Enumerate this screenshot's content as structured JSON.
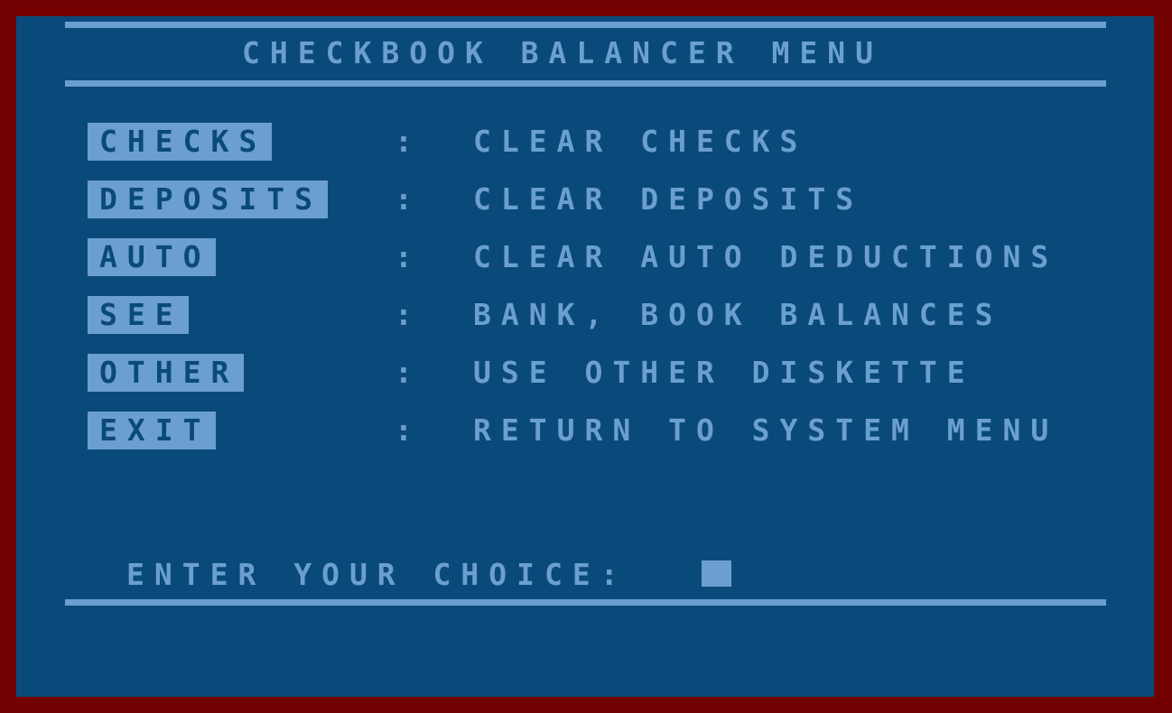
{
  "screen": {
    "title": "CHECKBOOK BALANCER MENU",
    "bezel_color": "#730000",
    "background_color": "#0a4a7a",
    "text_color": "#6b9fd0",
    "highlight_bg_color": "#6b9fd0",
    "highlight_text_color": "#0a4a7a"
  },
  "menu": {
    "separator": ":",
    "items": [
      {
        "keyword": "CHECKS",
        "description": "CLEAR CHECKS"
      },
      {
        "keyword": "DEPOSITS",
        "description": "CLEAR DEPOSITS"
      },
      {
        "keyword": "AUTO",
        "description": "CLEAR AUTO DEDUCTIONS"
      },
      {
        "keyword": "SEE",
        "description": "BANK, BOOK BALANCES"
      },
      {
        "keyword": "OTHER",
        "description": "USE OTHER DISKETTE"
      },
      {
        "keyword": "EXIT",
        "description": "RETURN TO SYSTEM MENU"
      }
    ]
  },
  "prompt": {
    "label": "ENTER YOUR CHOICE:",
    "value": "",
    "cursor": "block-cursor"
  }
}
